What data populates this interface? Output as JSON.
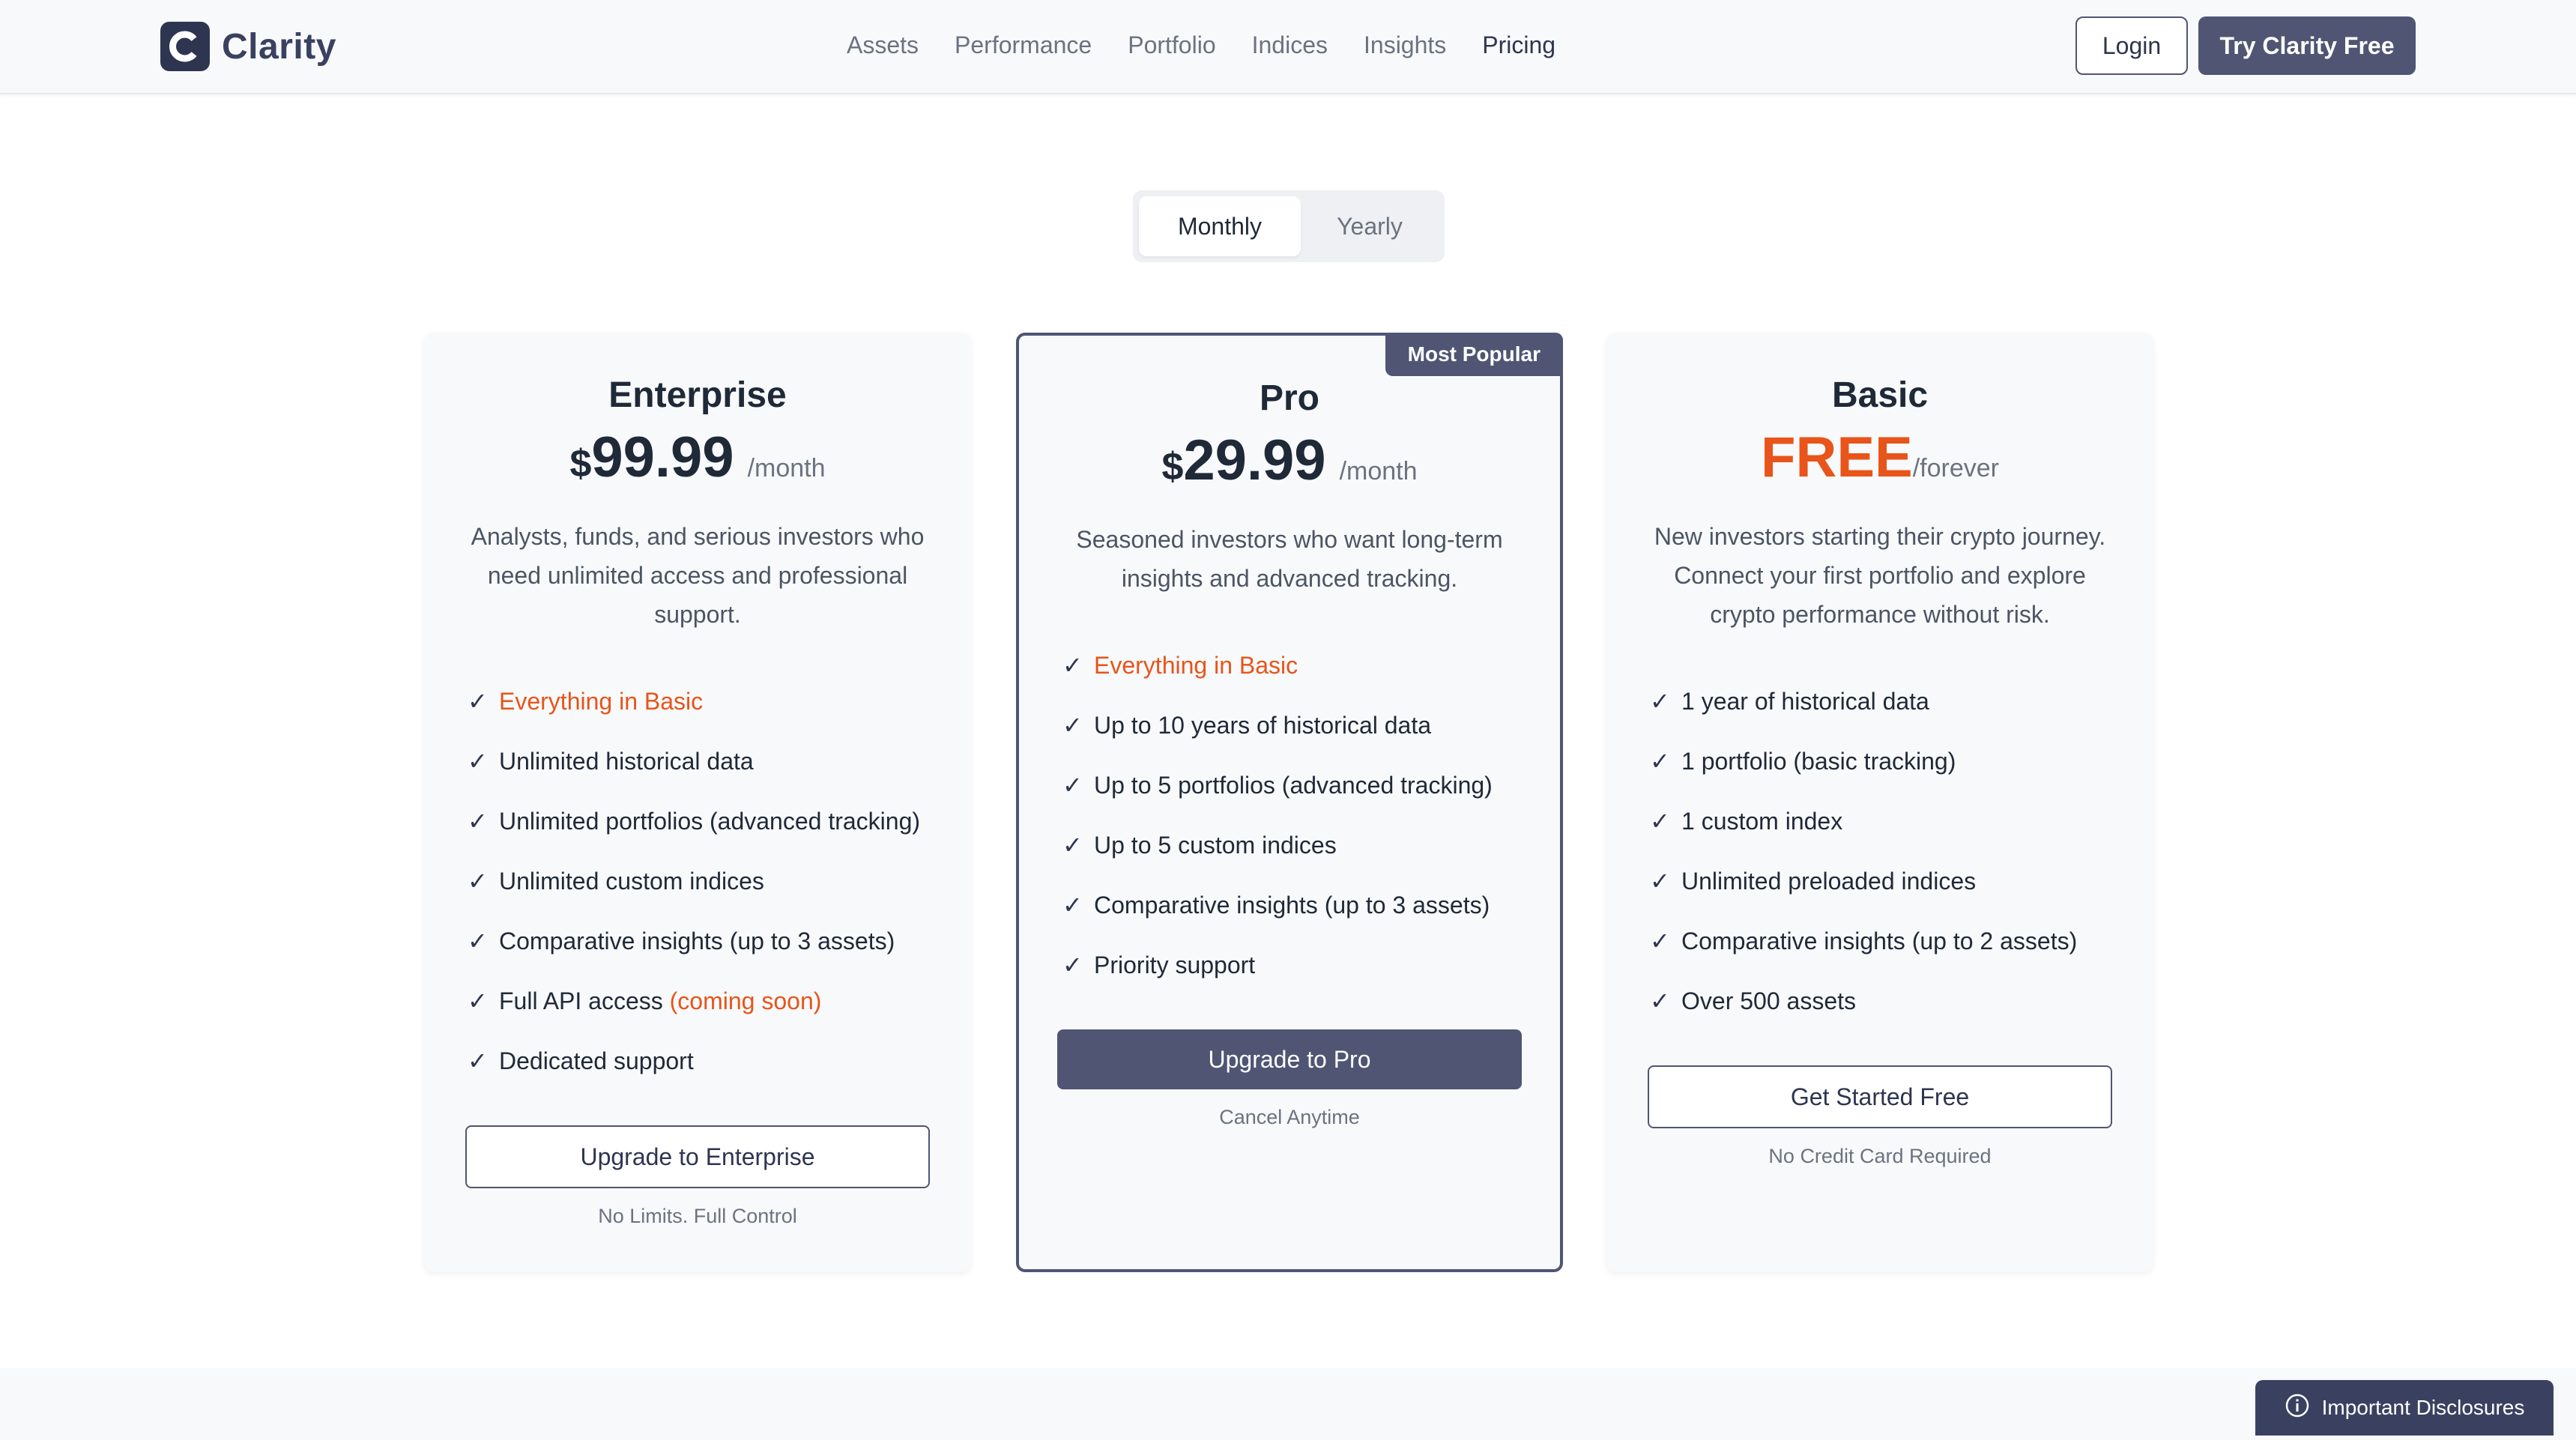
{
  "brand": {
    "name": "Clarity",
    "logo_letter": "C"
  },
  "nav": {
    "items": [
      {
        "label": "Assets"
      },
      {
        "label": "Performance"
      },
      {
        "label": "Portfolio"
      },
      {
        "label": "Indices"
      },
      {
        "label": "Insights"
      },
      {
        "label": "Pricing",
        "active": true
      }
    ]
  },
  "header_actions": {
    "login": "Login",
    "try": "Try Clarity Free"
  },
  "billing_toggle": {
    "monthly": "Monthly",
    "yearly": "Yearly",
    "selected": "Monthly"
  },
  "plans": [
    {
      "name": "Enterprise",
      "currency": "$",
      "price": "99.99",
      "period": "/month",
      "description": "Analysts, funds, and serious investors who need unlimited access and professional support.",
      "features": [
        {
          "text": "Everything in Basic",
          "highlight": true
        },
        {
          "text": "Unlimited historical data"
        },
        {
          "text": "Unlimited portfolios (advanced tracking)"
        },
        {
          "text": "Unlimited custom indices"
        },
        {
          "text": "Comparative insights (up to 3 assets)"
        },
        {
          "text": "Full API access ",
          "suffix": "(coming soon)"
        },
        {
          "text": "Dedicated support"
        }
      ],
      "cta": "Upgrade to Enterprise",
      "note": "No Limits. Full Control"
    },
    {
      "name": "Pro",
      "badge": "Most Popular",
      "currency": "$",
      "price": "29.99",
      "period": "/month",
      "description": "Seasoned investors who want long-term insights and advanced tracking.",
      "features": [
        {
          "text": "Everything in Basic",
          "highlight": true
        },
        {
          "text": "Up to 10 years of historical data"
        },
        {
          "text": "Up to 5 portfolios (advanced tracking)"
        },
        {
          "text": "Up to 5 custom indices"
        },
        {
          "text": "Comparative insights (up to 3 assets)"
        },
        {
          "text": "Priority support"
        }
      ],
      "cta": "Upgrade to Pro",
      "note": "Cancel Anytime"
    },
    {
      "name": "Basic",
      "price": "FREE",
      "period": "/forever",
      "description": "New investors starting their crypto journey. Connect your first portfolio and explore crypto performance without risk.",
      "features": [
        {
          "text": "1 year of historical data"
        },
        {
          "text": "1 portfolio (basic tracking)"
        },
        {
          "text": "1 custom index"
        },
        {
          "text": "Unlimited preloaded indices"
        },
        {
          "text": "Comparative insights (up to 2 assets)"
        },
        {
          "text": "Over 500 assets"
        }
      ],
      "cta": "Get Started Free",
      "note": "No Credit Card Required"
    }
  ],
  "check_glyph": "✓",
  "disclosures": {
    "label": "Important Disclosures",
    "icon": "info-icon"
  },
  "colors": {
    "primary": "#4f5573",
    "accent": "#e8541a",
    "brand_dark": "#2e3550"
  }
}
